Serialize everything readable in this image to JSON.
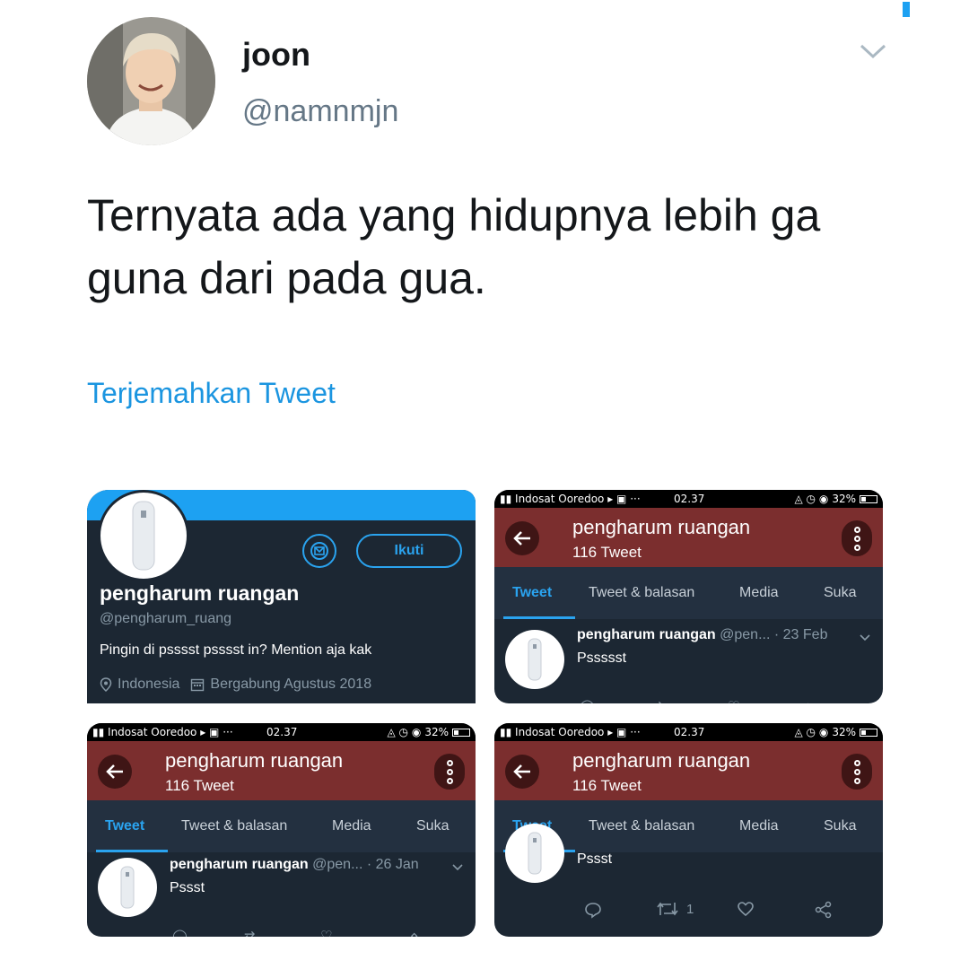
{
  "tweet": {
    "display_name": "joon",
    "handle": "@namnmjn",
    "text": "Ternyata ada yang hidupnya lebih ga guna dari pada gua.",
    "translate_link": "Terjemahkan Tweet"
  },
  "profile_panel": {
    "follow_label": "Ikuti",
    "name": "pengharum ruangan",
    "handle": "@pengharum_ruang",
    "bio": "Pingin di psssst psssst in? Mention aja kak",
    "location": "Indonesia",
    "joined": "Bergabung Agustus 2018",
    "banner_color": "#1da1f2"
  },
  "status_bar": {
    "carrier": "Indosat Ooredoo",
    "time": "02.37",
    "battery": "32%"
  },
  "app": {
    "title": "pengharum ruangan",
    "subtitle": "116 Tweet",
    "header_color": "#7b2e2e",
    "tabs": [
      "Tweet",
      "Tweet & balasan",
      "Media",
      "Suka"
    ]
  },
  "panels": [
    {
      "name": "pengharum ruangan",
      "handle": "@pen...",
      "date": "· 23 Feb",
      "text": "Pssssst"
    },
    {
      "name": "pengharum ruangan",
      "handle": "@pen...",
      "date": "· 26 Jan",
      "text": "Pssst"
    },
    {
      "text": "Pssst",
      "retweet_count": "1"
    }
  ]
}
